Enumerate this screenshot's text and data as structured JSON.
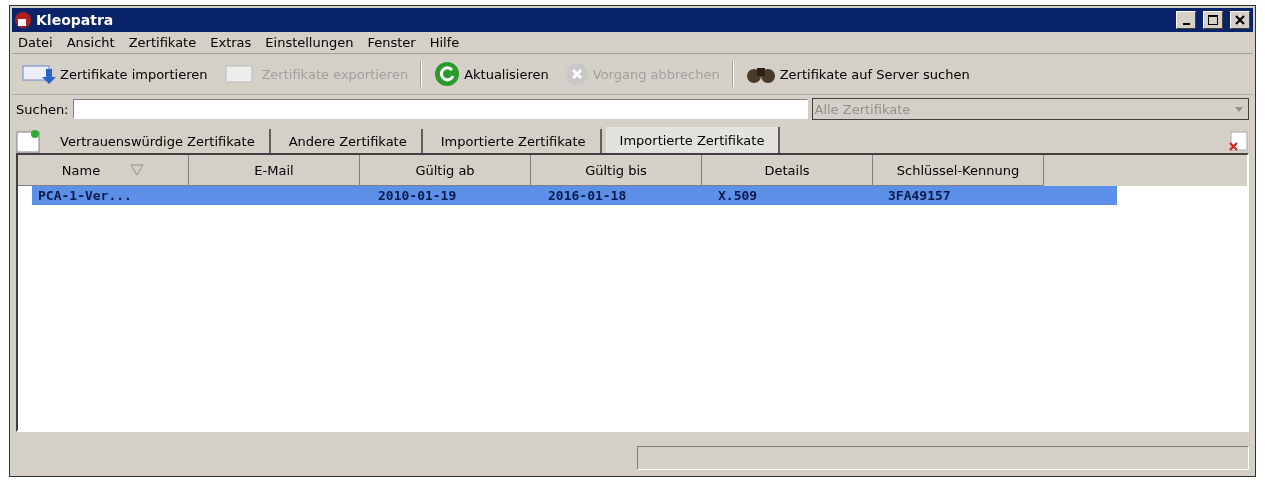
{
  "window": {
    "title": "Kleopatra"
  },
  "menu": [
    "Datei",
    "Ansicht",
    "Zertifikate",
    "Extras",
    "Einstellungen",
    "Fenster",
    "Hilfe"
  ],
  "toolbar": [
    {
      "kind": "import",
      "label": "Zertifikate importieren",
      "disabled": false
    },
    {
      "kind": "export",
      "label": "Zertifikate exportieren",
      "disabled": true
    },
    {
      "kind": "separator"
    },
    {
      "kind": "refresh",
      "label": "Aktualisieren",
      "disabled": false
    },
    {
      "kind": "cancel",
      "label": "Vorgang abbrechen",
      "disabled": true
    },
    {
      "kind": "separator"
    },
    {
      "kind": "search",
      "label": "Zertifikate auf Server suchen",
      "disabled": false
    }
  ],
  "search": {
    "label": "Suchen:",
    "filter": "Alle Zertifikate"
  },
  "tabs": [
    {
      "label": "Vertrauenswürdige Zertifikate",
      "selected": false
    },
    {
      "label": "Andere Zertifikate",
      "selected": false
    },
    {
      "label": "Importierte Zertifikate",
      "selected": false
    },
    {
      "label": "Importierte Zertifikate",
      "selected": true
    }
  ],
  "table": {
    "columns": [
      {
        "label": "Name",
        "sorted": true
      },
      {
        "label": "E-Mail",
        "sorted": false
      },
      {
        "label": "Gültig ab",
        "sorted": false
      },
      {
        "label": "Gültig bis",
        "sorted": false
      },
      {
        "label": "Details",
        "sorted": false
      },
      {
        "label": "Schlüssel-Kennung",
        "sorted": false
      }
    ],
    "rows": [
      {
        "selected": true,
        "cells": [
          "PCA-1-Ver...",
          "",
          "2010-01-19",
          "2016-01-18",
          "X.509",
          "3FA49157"
        ]
      }
    ]
  }
}
